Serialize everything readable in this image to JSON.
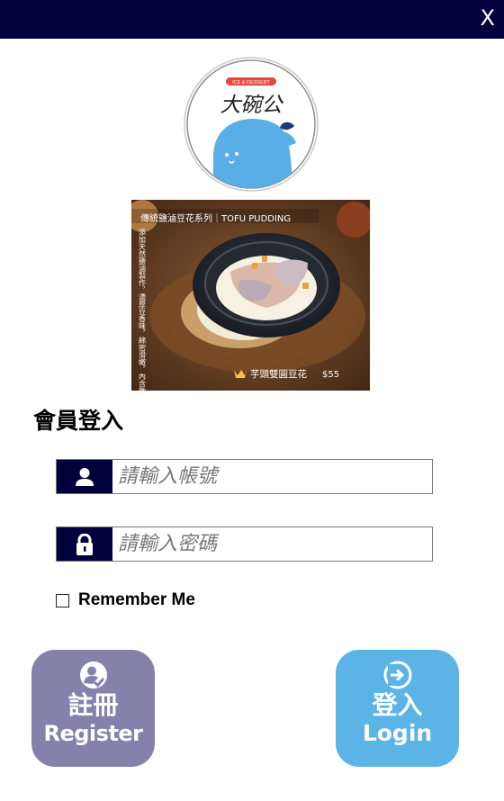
{
  "topbar": {
    "close_label": "X"
  },
  "logo": {
    "badge_text": "ICE & DESSERT",
    "brand_name": "大碗公"
  },
  "banner": {
    "series_title": "傳統鹽滷豆花系列｜TOFU PUDDING",
    "description": "添加天然鹽滷製作，濃厚豆香味，綿密滑嫩，內含微量元素",
    "product_name": "芋頭雙圓豆花",
    "price": "$55"
  },
  "login": {
    "title": "會員登入",
    "username_placeholder": "請輸入帳號",
    "password_placeholder": "請輸入密碼",
    "remember_label": "Remember Me"
  },
  "actions": {
    "register_zh": "註冊",
    "register_en": "Register",
    "login_zh": "登入",
    "login_en": "Login"
  },
  "colors": {
    "navy": "#00003b",
    "register": "#8681ab",
    "login": "#5bb3e6",
    "logo_blue": "#5aaee6",
    "logo_red": "#e8483c"
  }
}
